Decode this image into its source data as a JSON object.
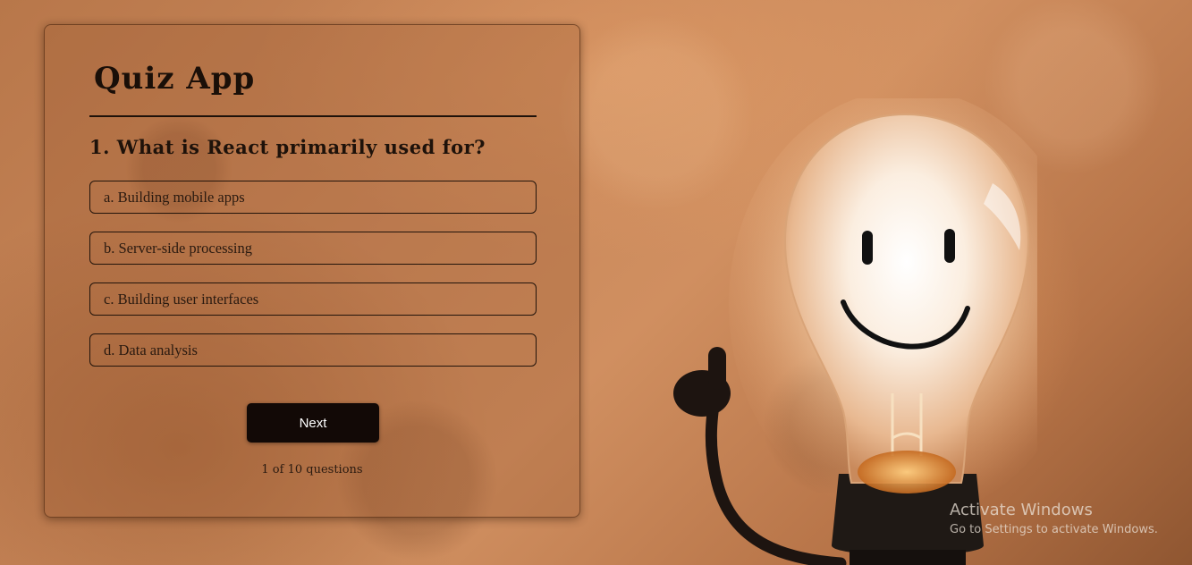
{
  "app": {
    "title": "Quiz App"
  },
  "quiz": {
    "question": "1. What is React primarily used for?",
    "options": [
      "a. Building mobile apps",
      "b. Server-side processing",
      "c. Building user interfaces",
      "d. Data analysis"
    ],
    "next_label": "Next",
    "progress_text": "1 of 10 questions"
  },
  "watermark": {
    "title": "Activate Windows",
    "subtitle": "Go to Settings to activate Windows."
  },
  "colors": {
    "background": "#c9875a",
    "card_text": "#1e120a",
    "button_bg": "#120906",
    "button_text": "#ffffff"
  },
  "icons": {
    "illustration": "smiling-lightbulb-icon"
  }
}
